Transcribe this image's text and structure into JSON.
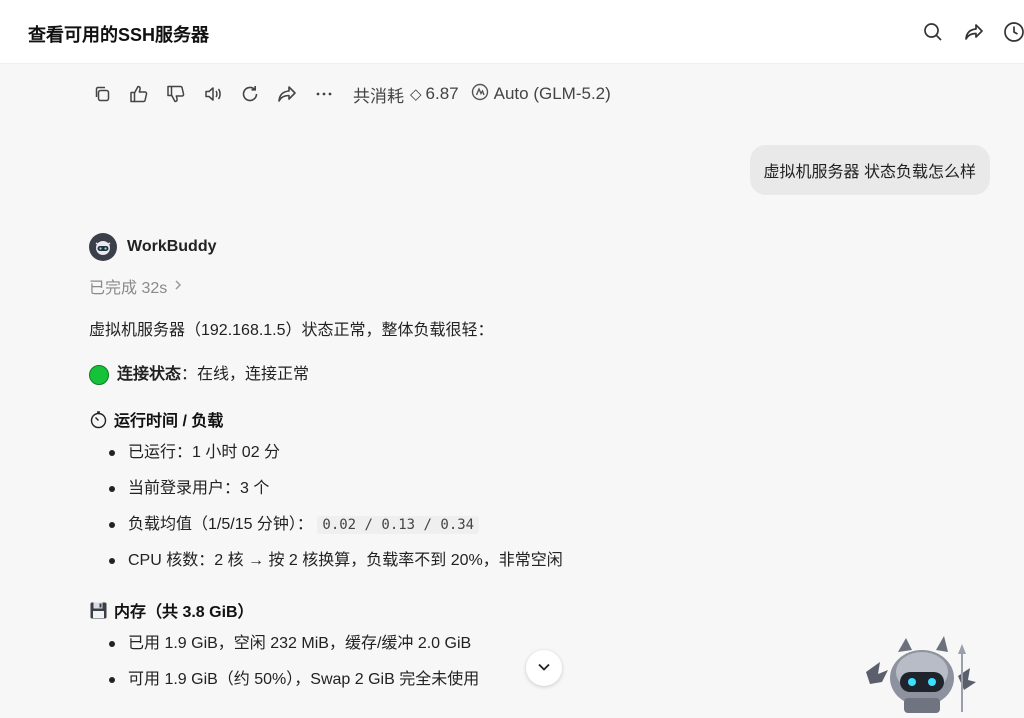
{
  "header": {
    "title": "查看可用的SSH服务器",
    "icons": [
      "search-icon",
      "share-icon",
      "history-icon"
    ]
  },
  "message_actions": {
    "icons": [
      "copy-icon",
      "thumbs-up-icon",
      "thumbs-down-icon",
      "speaker-icon",
      "regenerate-icon",
      "share-icon",
      "more-icon"
    ],
    "cost_label": "共消耗",
    "cost_value": "6.87",
    "model": "Auto (GLM-5.2)"
  },
  "user_message": "虚拟机服务器 状态负载怎么样",
  "assistant": {
    "name": "WorkBuddy",
    "status": "已完成 32s",
    "intro": "虚拟机服务器（192.168.1.5）状态正常，整体负载很轻：",
    "connection": {
      "label": "连接状态",
      "value": "：在线，连接正常"
    },
    "uptime_section": {
      "title": "运行时间 / 负载",
      "items": [
        "已运行：1 小时 02 分",
        "当前登录用户：3 个"
      ],
      "load_label": "负载均值（1/5/15 分钟）：",
      "load_values": "0.02 / 0.13 / 0.34",
      "cpu_line": "CPU 核数：2 核 → 按 2 核换算，负载率不到 20%，非常空闲"
    },
    "memory_section": {
      "title": "内存（共 3.8 GiB）",
      "items": [
        "已用 1.9 GiB，空闲 232 MiB，缓存/缓冲 2.0 GiB",
        "可用 1.9 GiB（约 50%），Swap 2 GiB 完全未使用"
      ]
    }
  },
  "colors": {
    "background": "#f7f7f7",
    "user_bubble": "#e9e9e9",
    "status_green": "#16c23a"
  }
}
